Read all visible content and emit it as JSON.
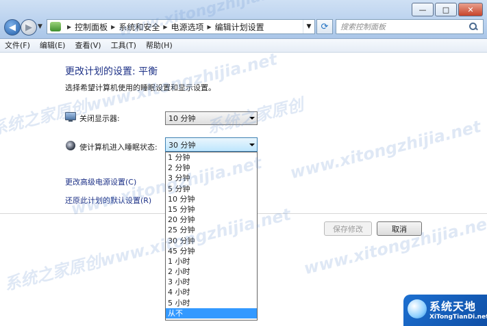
{
  "window": {
    "minimize": "—",
    "maximize": "□",
    "close": "✕"
  },
  "address": {
    "breadcrumb": [
      "控制面板",
      "系统和安全",
      "电源选项",
      "编辑计划设置"
    ],
    "icon": "control-panel-icon"
  },
  "search": {
    "placeholder": "搜索控制面板"
  },
  "menu": [
    "文件(F)",
    "编辑(E)",
    "查看(V)",
    "工具(T)",
    "帮助(H)"
  ],
  "page": {
    "title": "更改计划的设置: 平衡",
    "description": "选择希望计算机使用的睡眠设置和显示设置。"
  },
  "settings": {
    "display_label": "关闭显示器:",
    "display_value": "10 分钟",
    "sleep_label": "使计算机进入睡眠状态:",
    "sleep_value": "30 分钟"
  },
  "dropdown": {
    "options": [
      "1 分钟",
      "2 分钟",
      "3 分钟",
      "5 分钟",
      "10 分钟",
      "15 分钟",
      "20 分钟",
      "25 分钟",
      "30 分钟",
      "45 分钟",
      "1 小时",
      "2 小时",
      "3 小时",
      "4 小时",
      "5 小时",
      "从不"
    ],
    "highlighted": "从不"
  },
  "links": {
    "advanced": "更改高级电源设置(C)",
    "restore": "还原此计划的默认设置(R)"
  },
  "buttons": {
    "save": "保存修改",
    "cancel": "取消"
  },
  "watermark": {
    "text_a": "系统之家原创www.xitongzhijia.net",
    "text_b": "www.xitongzhijia.net",
    "text_c": "系统之家原创"
  },
  "brand": {
    "name": "系统天地",
    "url": "XiTongTianDi.net"
  },
  "colors": {
    "link": "#1e3287",
    "highlight": "#3399ff"
  }
}
